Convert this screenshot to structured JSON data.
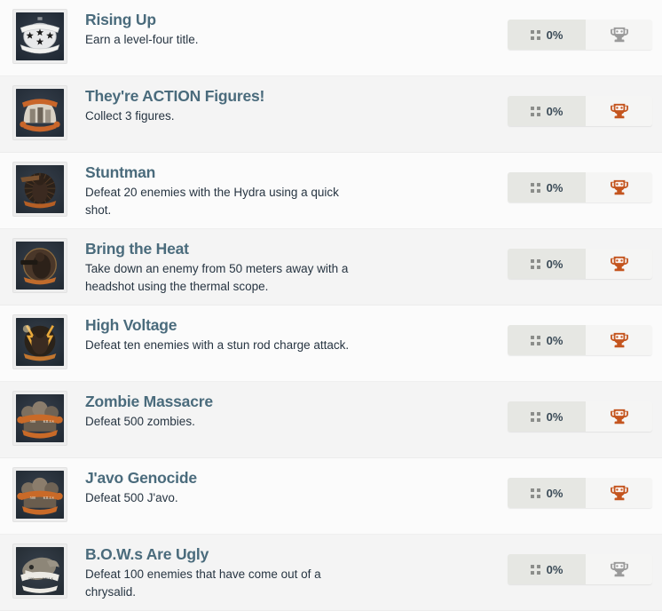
{
  "list": {
    "name": "achievements-list",
    "rows": [
      {
        "title": "Rising Up",
        "description": "Earn a level-four title.",
        "progress": "0%",
        "trophy": "trophy-icon",
        "trophy_state": "locked",
        "trophy_color": "#9a9a9a",
        "icon_alt": "three-stars-emblem"
      },
      {
        "title": "They're ACTION Figures!",
        "description": "Collect 3 figures.",
        "progress": "0%",
        "trophy": "trophy-icon",
        "trophy_state": "bronze",
        "trophy_color": "#c4551f",
        "icon_alt": "three-figures-crest"
      },
      {
        "title": "Stuntman",
        "description": "Defeat 20 enemies with the Hydra using a quick shot.",
        "progress": "0%",
        "trophy": "trophy-icon",
        "trophy_state": "bronze",
        "trophy_color": "#c4551f",
        "icon_alt": "shotgun-character-crest"
      },
      {
        "title": "Bring the Heat",
        "description": "Take down an enemy from 50 meters away with a headshot using the thermal scope.",
        "progress": "0%",
        "trophy": "trophy-icon",
        "trophy_state": "bronze",
        "trophy_color": "#c4551f",
        "icon_alt": "sniper-character-crest"
      },
      {
        "title": "High Voltage",
        "description": "Defeat ten enemies with a stun rod charge attack.",
        "progress": "0%",
        "trophy": "trophy-icon",
        "trophy_state": "bronze",
        "trophy_color": "#c4551f",
        "icon_alt": "lightning-character-crest"
      },
      {
        "title": "Zombie Massacre",
        "description": "Defeat 500 zombies.",
        "progress": "0%",
        "trophy": "trophy-icon",
        "trophy_state": "bronze",
        "trophy_color": "#c4551f",
        "icon_alt": "zombie-horde-crest"
      },
      {
        "title": "J'avo Genocide",
        "description": "Defeat 500 J'avo.",
        "progress": "0%",
        "trophy": "trophy-icon",
        "trophy_state": "bronze",
        "trophy_color": "#c4551f",
        "icon_alt": "javo-horde-crest"
      },
      {
        "title": "B.O.W.s Are Ugly",
        "description": "Defeat 100 enemies that have come out of a chrysalid.",
        "progress": "0%",
        "trophy": "trophy-icon",
        "trophy_state": "locked",
        "trophy_color": "#9a9a9a",
        "icon_alt": "bow-creature-crest"
      }
    ]
  },
  "theme": {
    "row_bg": "#fbfbfb",
    "row_bg_alt": "#f4f4f4",
    "title_color": "#4a6b7c",
    "desc_color": "#273542",
    "progress_bg": "#e6e7e3",
    "trophy_bg": "#f5f5f4",
    "trophy_bronze": "#c4551f",
    "trophy_locked": "#9a9a9a"
  }
}
